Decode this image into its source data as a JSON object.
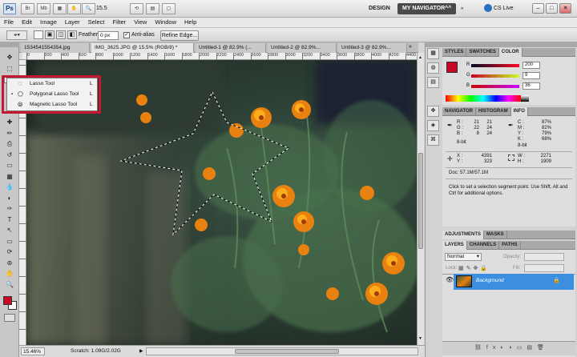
{
  "app": {
    "logo": "Ps",
    "bar_buttons": [
      "Br",
      "Mb",
      "",
      "",
      "",
      ""
    ],
    "zoom": "15.5",
    "workspace_design": "DESIGN",
    "workspace_active": "MY NAVIGATOR^^",
    "cs_live": "CS Live",
    "win_min": "–",
    "win_max": "□",
    "win_close": "✕"
  },
  "menu": [
    "File",
    "Edit",
    "Image",
    "Layer",
    "Select",
    "Filter",
    "View",
    "Window",
    "Help"
  ],
  "options": {
    "feather_label": "Feather:",
    "feather_value": "0 px",
    "antialias_label": "Anti-alias",
    "refine_edge": "Refine Edge..."
  },
  "doc_tabs": [
    {
      "label": "1534541554354.jpg",
      "active": false
    },
    {
      "label": "IMG_3625.JPG @ 15.5% (RGB/8) *",
      "active": true
    },
    {
      "label": "Untitled-1 @ 82.9% (...",
      "active": false
    },
    {
      "label": "Untitled-2 @ 82.9%...",
      "active": false
    },
    {
      "label": "Untitled-3 @ 82.9%...",
      "active": false
    }
  ],
  "ruler_h": [
    "0",
    "200",
    "400",
    "600",
    "800",
    "1000",
    "1200",
    "1400",
    "1600",
    "1800",
    "2000",
    "2200",
    "2400",
    "2600",
    "2800",
    "3000",
    "3200",
    "3400",
    "3600",
    "3800",
    "4000",
    "4200",
    "4400"
  ],
  "flyout": {
    "items": [
      {
        "label": "Lasso Tool",
        "key": "L",
        "selected": false
      },
      {
        "label": "Polygonal Lasso Tool",
        "key": "L",
        "selected": true
      },
      {
        "label": "Magnetic Lasso Tool",
        "key": "L",
        "selected": false
      }
    ]
  },
  "status": {
    "zoom": "15.46%",
    "scratch": "Scratch: 1.09G/2.02G"
  },
  "color_panel": {
    "tabs": [
      "STYLES",
      "SWATCHES",
      "COLOR"
    ],
    "channels": [
      {
        "label": "R",
        "value": "200"
      },
      {
        "label": "G",
        "value": "9"
      },
      {
        "label": "B",
        "value": "36"
      }
    ],
    "fg_color": "#c80924"
  },
  "info_panel": {
    "tabs": [
      "NAVIGATOR",
      "HISTOGRAM",
      "INFO"
    ],
    "rgb_labels": [
      "R :",
      "G :",
      "B :"
    ],
    "rgb_values_a": [
      "21",
      "22",
      "8"
    ],
    "rgb_values_b": [
      "21",
      "24",
      "24"
    ],
    "rgb_bitdepth": "8-bit",
    "cmyk_labels": [
      "C :",
      "M :",
      "Y :",
      "K :"
    ],
    "cmyk_values": [
      "87%",
      "82%",
      "79%",
      "68%"
    ],
    "cmyk_bitdepth": "8-bit",
    "x_label": "X :",
    "x_value": "4391",
    "y_label": "Y :",
    "y_value": "323",
    "w_label": "W :",
    "w_value": "2271",
    "h_label": "H :",
    "h_value": "1909",
    "doc": "Doc: 57.1M/57.1M",
    "hint": "Click to set a selection segment point. Use Shift, Alt and Ctrl for additional options."
  },
  "adjust_panel": {
    "tabs": [
      "ADJUSTMENTS",
      "MASKS"
    ]
  },
  "layers_panel": {
    "tabs": [
      "LAYERS",
      "CHANNELS",
      "PATHS"
    ],
    "blend_mode": "Normal",
    "opacity_label": "Opacity:",
    "lock_label": "Lock:",
    "fill_label": "Fill:",
    "layer_name": "Background"
  },
  "icons": {
    "tools": [
      "move-icon",
      "marquee-icon",
      "lasso-icon",
      "quick-select-icon",
      "crop-icon",
      "eyedropper-icon",
      "healing-icon",
      "brush-icon",
      "clone-stamp-icon",
      "history-brush-icon",
      "eraser-icon",
      "gradient-icon",
      "blur-icon",
      "dodge-icon",
      "pen-icon",
      "type-icon",
      "path-select-icon",
      "shape-icon",
      "3d-rotate-icon",
      "3d-orbit-icon",
      "hand-icon",
      "zoom-icon"
    ],
    "tool_glyphs": [
      "✥",
      "⬚",
      "◌",
      "✎",
      "⌗",
      "✒",
      "✚",
      "✏",
      "⎙",
      "↺",
      "▭",
      "▦",
      "💧",
      "◐",
      "✑",
      "T",
      "↖",
      "▭",
      "⟳",
      "⊚",
      "✋",
      "🔍"
    ]
  }
}
